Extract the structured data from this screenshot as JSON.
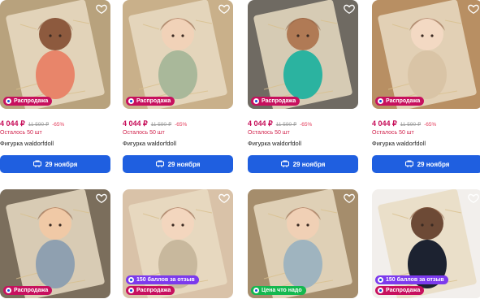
{
  "cards": [
    {
      "price": "4 044 ₽",
      "old_price": "11 590 ₽",
      "discount": "-65%",
      "stock": "Осталось 50 шт",
      "title": "Фигурка waldorfdoll",
      "button": "29 ноября",
      "badges": [
        "Распродажа"
      ],
      "bg": "#b8a27d",
      "doll": "#8d5a3e",
      "dress": "#e8856a"
    },
    {
      "price": "4 044 ₽",
      "old_price": "11 590 ₽",
      "discount": "-65%",
      "stock": "Осталось 50 шт",
      "title": "Фигурка waldorfdoll",
      "button": "29 ноября",
      "badges": [
        "Распродажа"
      ],
      "bg": "#c9b08a",
      "doll": "#f1d2b8",
      "dress": "#a9b89a"
    },
    {
      "price": "4 044 ₽",
      "old_price": "11 590 ₽",
      "discount": "-65%",
      "stock": "Осталось 50 шт",
      "title": "Фигурка waldorfdoll",
      "button": "29 ноября",
      "badges": [
        "Распродажа"
      ],
      "bg": "#6f6a62",
      "doll": "#b07a55",
      "dress": "#2bb3a0"
    },
    {
      "price": "4 044 ₽",
      "old_price": "11 590 ₽",
      "discount": "-65%",
      "stock": "Осталось 50 шт",
      "title": "Фигурка waldorfdoll",
      "button": "29 ноября",
      "badges": [
        "Распродажа"
      ],
      "bg": "#b88f63",
      "doll": "#f3d9c3",
      "dress": "#d9c4a6"
    },
    {
      "badges": [
        "Распродажа"
      ],
      "bg": "#7b6e5c",
      "doll": "#f0c9a6",
      "dress": "#8fa0b0"
    },
    {
      "badges": [
        "150 баллов за отзыв",
        "Распродажа"
      ],
      "bg": "#d9c2a8",
      "doll": "#f3d6be",
      "dress": "#c8b89d"
    },
    {
      "badges": [
        "Цена что надо"
      ],
      "bg": "#a58d6c",
      "doll": "#f0d0b5",
      "dress": "#9fb4bf"
    },
    {
      "badges": [
        "150 баллов за отзыв",
        "Распродажа"
      ],
      "bg": "#f2efec",
      "doll": "#6d4a36",
      "dress": "#1c2230"
    }
  ]
}
